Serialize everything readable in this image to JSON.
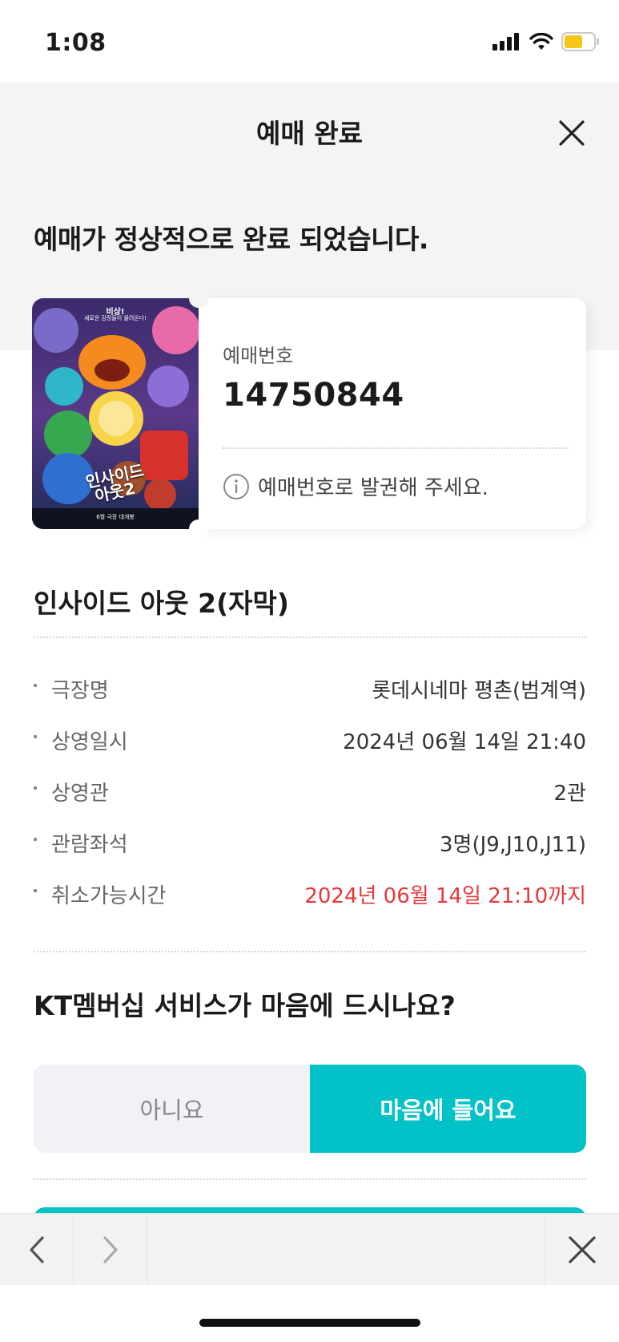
{
  "status_bar": {
    "time": "1:08"
  },
  "header": {
    "title": "예매 완료"
  },
  "headline": "예매가 정상적으로 완료 되었습니다.",
  "ticket": {
    "booking_label": "예매번호",
    "booking_number": "14750844",
    "notice": "예매번호로 발권해 주세요.",
    "poster": {
      "top_text": "비상!",
      "sub_text": "새로운 감정들이 몰려온다!",
      "title_line1": "인사이드",
      "title_line2": "아웃2",
      "release": "6월 극장 대개봉"
    }
  },
  "movie": {
    "title": "인사이드 아웃 2(자막)",
    "details": [
      {
        "label": "극장명",
        "value": "롯데시네마 평촌(범계역)",
        "highlight": false
      },
      {
        "label": "상영일시",
        "value": "2024년 06월 14일 21:40",
        "highlight": false
      },
      {
        "label": "상영관",
        "value": "2관",
        "highlight": false
      },
      {
        "label": "관람좌석",
        "value": "3명(J9,J10,J11)",
        "highlight": false
      },
      {
        "label": "취소가능시간",
        "value": "2024년 06월 14일 21:10까지",
        "highlight": true
      }
    ]
  },
  "survey": {
    "question": "KT멤버십 서비스가 마음에 드시나요?",
    "no_label": "아니요",
    "yes_label": "마음에 들어요"
  },
  "colors": {
    "accent": "#00c2c7",
    "warning": "#e5383b",
    "band": "#f3f4f6"
  },
  "icons": {
    "close": "close-icon",
    "info": "info-icon",
    "back": "chevron-left-icon",
    "forward": "chevron-right-icon"
  }
}
